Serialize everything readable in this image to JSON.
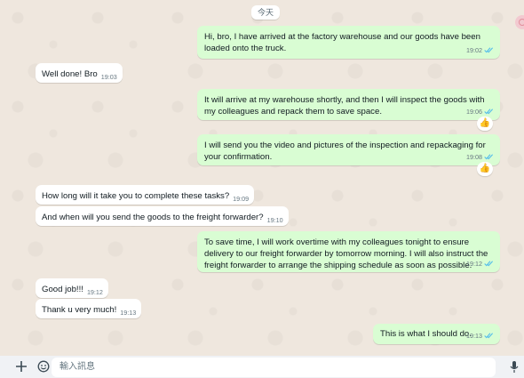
{
  "date_chip": "今天",
  "messages": [
    {
      "dir": "out",
      "text": "Hi, bro, I have arrived at the factory warehouse and our goods have been loaded onto the truck.",
      "time": "19:02",
      "read": true
    },
    {
      "dir": "in",
      "text": "Well done! Bro",
      "time": "19:03"
    },
    {
      "dir": "out",
      "text": "It will arrive at my warehouse shortly, and then I will inspect the goods with my colleagues and repack them to save space.",
      "time": "19:06",
      "read": true,
      "reaction": "👍"
    },
    {
      "dir": "out",
      "text": "I will send you the video and pictures of the inspection and repackaging for your confirmation.",
      "time": "19:08",
      "read": true,
      "reaction": "👍"
    },
    {
      "dir": "in",
      "text": "How long will it take you to complete these tasks?",
      "time": "19:09"
    },
    {
      "dir": "in",
      "text": "And when will you send the goods to the freight forwarder?",
      "time": "19:10"
    },
    {
      "dir": "out",
      "text": "To save time, I will work overtime with my colleagues tonight to ensure delivery to our freight forwarder by tomorrow morning. I will also instruct the freight forwarder to arrange the shipping schedule as soon as possible.",
      "time": "19:12",
      "read": true
    },
    {
      "dir": "in",
      "text": "Good job!!!",
      "time": "19:12"
    },
    {
      "dir": "in",
      "text": "Thank u very much!",
      "time": "19:13"
    },
    {
      "dir": "out",
      "text": "This is what I should do.",
      "time": "19:13",
      "read": true
    }
  ],
  "composer": {
    "placeholder": "輸入訊息",
    "icons": [
      "plus-icon",
      "sticker-icon",
      "microphone-icon"
    ]
  },
  "colors": {
    "outgoing_bubble": "#d9fdd3",
    "incoming_bubble": "#ffffff",
    "read_tick": "#53bdeb",
    "chat_background": "#efe7de"
  }
}
